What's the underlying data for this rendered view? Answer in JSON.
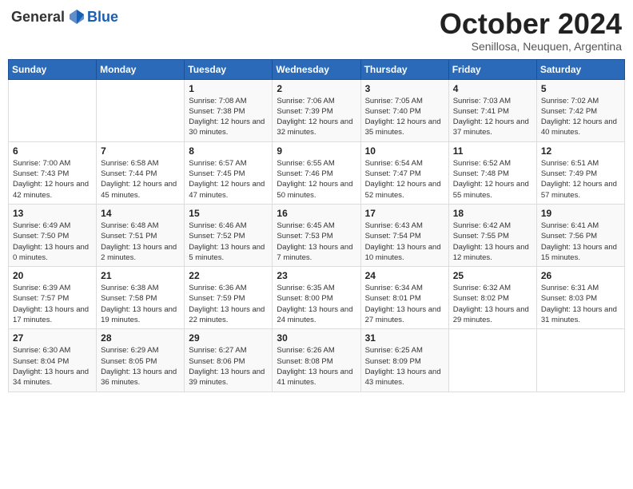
{
  "header": {
    "logo_general": "General",
    "logo_blue": "Blue",
    "month_title": "October 2024",
    "subtitle": "Senillosa, Neuquen, Argentina"
  },
  "weekdays": [
    "Sunday",
    "Monday",
    "Tuesday",
    "Wednesday",
    "Thursday",
    "Friday",
    "Saturday"
  ],
  "weeks": [
    [
      {
        "day": "",
        "info": ""
      },
      {
        "day": "",
        "info": ""
      },
      {
        "day": "1",
        "info": "Sunrise: 7:08 AM\nSunset: 7:38 PM\nDaylight: 12 hours and 30 minutes."
      },
      {
        "day": "2",
        "info": "Sunrise: 7:06 AM\nSunset: 7:39 PM\nDaylight: 12 hours and 32 minutes."
      },
      {
        "day": "3",
        "info": "Sunrise: 7:05 AM\nSunset: 7:40 PM\nDaylight: 12 hours and 35 minutes."
      },
      {
        "day": "4",
        "info": "Sunrise: 7:03 AM\nSunset: 7:41 PM\nDaylight: 12 hours and 37 minutes."
      },
      {
        "day": "5",
        "info": "Sunrise: 7:02 AM\nSunset: 7:42 PM\nDaylight: 12 hours and 40 minutes."
      }
    ],
    [
      {
        "day": "6",
        "info": "Sunrise: 7:00 AM\nSunset: 7:43 PM\nDaylight: 12 hours and 42 minutes."
      },
      {
        "day": "7",
        "info": "Sunrise: 6:58 AM\nSunset: 7:44 PM\nDaylight: 12 hours and 45 minutes."
      },
      {
        "day": "8",
        "info": "Sunrise: 6:57 AM\nSunset: 7:45 PM\nDaylight: 12 hours and 47 minutes."
      },
      {
        "day": "9",
        "info": "Sunrise: 6:55 AM\nSunset: 7:46 PM\nDaylight: 12 hours and 50 minutes."
      },
      {
        "day": "10",
        "info": "Sunrise: 6:54 AM\nSunset: 7:47 PM\nDaylight: 12 hours and 52 minutes."
      },
      {
        "day": "11",
        "info": "Sunrise: 6:52 AM\nSunset: 7:48 PM\nDaylight: 12 hours and 55 minutes."
      },
      {
        "day": "12",
        "info": "Sunrise: 6:51 AM\nSunset: 7:49 PM\nDaylight: 12 hours and 57 minutes."
      }
    ],
    [
      {
        "day": "13",
        "info": "Sunrise: 6:49 AM\nSunset: 7:50 PM\nDaylight: 13 hours and 0 minutes."
      },
      {
        "day": "14",
        "info": "Sunrise: 6:48 AM\nSunset: 7:51 PM\nDaylight: 13 hours and 2 minutes."
      },
      {
        "day": "15",
        "info": "Sunrise: 6:46 AM\nSunset: 7:52 PM\nDaylight: 13 hours and 5 minutes."
      },
      {
        "day": "16",
        "info": "Sunrise: 6:45 AM\nSunset: 7:53 PM\nDaylight: 13 hours and 7 minutes."
      },
      {
        "day": "17",
        "info": "Sunrise: 6:43 AM\nSunset: 7:54 PM\nDaylight: 13 hours and 10 minutes."
      },
      {
        "day": "18",
        "info": "Sunrise: 6:42 AM\nSunset: 7:55 PM\nDaylight: 13 hours and 12 minutes."
      },
      {
        "day": "19",
        "info": "Sunrise: 6:41 AM\nSunset: 7:56 PM\nDaylight: 13 hours and 15 minutes."
      }
    ],
    [
      {
        "day": "20",
        "info": "Sunrise: 6:39 AM\nSunset: 7:57 PM\nDaylight: 13 hours and 17 minutes."
      },
      {
        "day": "21",
        "info": "Sunrise: 6:38 AM\nSunset: 7:58 PM\nDaylight: 13 hours and 19 minutes."
      },
      {
        "day": "22",
        "info": "Sunrise: 6:36 AM\nSunset: 7:59 PM\nDaylight: 13 hours and 22 minutes."
      },
      {
        "day": "23",
        "info": "Sunrise: 6:35 AM\nSunset: 8:00 PM\nDaylight: 13 hours and 24 minutes."
      },
      {
        "day": "24",
        "info": "Sunrise: 6:34 AM\nSunset: 8:01 PM\nDaylight: 13 hours and 27 minutes."
      },
      {
        "day": "25",
        "info": "Sunrise: 6:32 AM\nSunset: 8:02 PM\nDaylight: 13 hours and 29 minutes."
      },
      {
        "day": "26",
        "info": "Sunrise: 6:31 AM\nSunset: 8:03 PM\nDaylight: 13 hours and 31 minutes."
      }
    ],
    [
      {
        "day": "27",
        "info": "Sunrise: 6:30 AM\nSunset: 8:04 PM\nDaylight: 13 hours and 34 minutes."
      },
      {
        "day": "28",
        "info": "Sunrise: 6:29 AM\nSunset: 8:05 PM\nDaylight: 13 hours and 36 minutes."
      },
      {
        "day": "29",
        "info": "Sunrise: 6:27 AM\nSunset: 8:06 PM\nDaylight: 13 hours and 39 minutes."
      },
      {
        "day": "30",
        "info": "Sunrise: 6:26 AM\nSunset: 8:08 PM\nDaylight: 13 hours and 41 minutes."
      },
      {
        "day": "31",
        "info": "Sunrise: 6:25 AM\nSunset: 8:09 PM\nDaylight: 13 hours and 43 minutes."
      },
      {
        "day": "",
        "info": ""
      },
      {
        "day": "",
        "info": ""
      }
    ]
  ]
}
